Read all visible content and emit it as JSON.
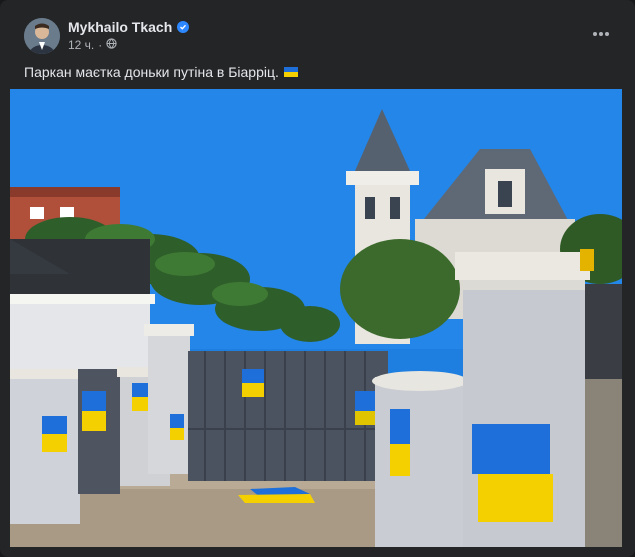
{
  "post": {
    "author": "Mykhailo Tkach",
    "time": "12 ч.",
    "caption": "Паркан маєтка доньки путіна в Біарріц.",
    "caption_emoji": "ukraine-flag",
    "verified": true,
    "privacy_icon": "globe-icon",
    "menu_icon": "more-options-icon"
  },
  "colors": {
    "background": "#242526",
    "text_primary": "#e4e6eb",
    "text_secondary": "#b0b3b8",
    "verified_badge": "#2d88ff",
    "flag_blue": "#1e6fd9",
    "flag_yellow": "#f5d000"
  },
  "photo": {
    "description_icon": "fence-photo"
  }
}
